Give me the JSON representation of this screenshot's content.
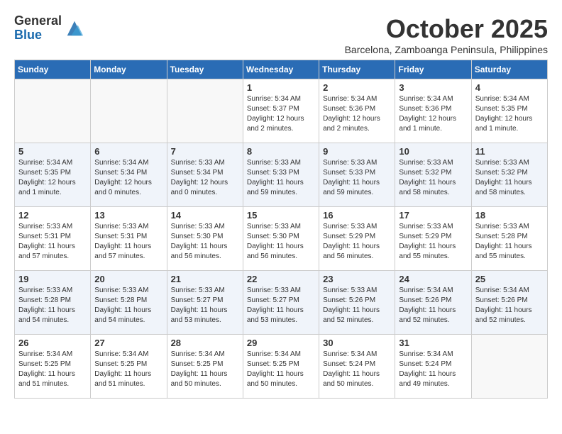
{
  "header": {
    "logo_general": "General",
    "logo_blue": "Blue",
    "month_title": "October 2025",
    "subtitle": "Barcelona, Zamboanga Peninsula, Philippines"
  },
  "weekdays": [
    "Sunday",
    "Monday",
    "Tuesday",
    "Wednesday",
    "Thursday",
    "Friday",
    "Saturday"
  ],
  "weeks": [
    [
      {
        "day": "",
        "info": ""
      },
      {
        "day": "",
        "info": ""
      },
      {
        "day": "",
        "info": ""
      },
      {
        "day": "1",
        "info": "Sunrise: 5:34 AM\nSunset: 5:37 PM\nDaylight: 12 hours\nand 2 minutes."
      },
      {
        "day": "2",
        "info": "Sunrise: 5:34 AM\nSunset: 5:36 PM\nDaylight: 12 hours\nand 2 minutes."
      },
      {
        "day": "3",
        "info": "Sunrise: 5:34 AM\nSunset: 5:36 PM\nDaylight: 12 hours\nand 1 minute."
      },
      {
        "day": "4",
        "info": "Sunrise: 5:34 AM\nSunset: 5:35 PM\nDaylight: 12 hours\nand 1 minute."
      }
    ],
    [
      {
        "day": "5",
        "info": "Sunrise: 5:34 AM\nSunset: 5:35 PM\nDaylight: 12 hours\nand 1 minute."
      },
      {
        "day": "6",
        "info": "Sunrise: 5:34 AM\nSunset: 5:34 PM\nDaylight: 12 hours\nand 0 minutes."
      },
      {
        "day": "7",
        "info": "Sunrise: 5:33 AM\nSunset: 5:34 PM\nDaylight: 12 hours\nand 0 minutes."
      },
      {
        "day": "8",
        "info": "Sunrise: 5:33 AM\nSunset: 5:33 PM\nDaylight: 11 hours\nand 59 minutes."
      },
      {
        "day": "9",
        "info": "Sunrise: 5:33 AM\nSunset: 5:33 PM\nDaylight: 11 hours\nand 59 minutes."
      },
      {
        "day": "10",
        "info": "Sunrise: 5:33 AM\nSunset: 5:32 PM\nDaylight: 11 hours\nand 58 minutes."
      },
      {
        "day": "11",
        "info": "Sunrise: 5:33 AM\nSunset: 5:32 PM\nDaylight: 11 hours\nand 58 minutes."
      }
    ],
    [
      {
        "day": "12",
        "info": "Sunrise: 5:33 AM\nSunset: 5:31 PM\nDaylight: 11 hours\nand 57 minutes."
      },
      {
        "day": "13",
        "info": "Sunrise: 5:33 AM\nSunset: 5:31 PM\nDaylight: 11 hours\nand 57 minutes."
      },
      {
        "day": "14",
        "info": "Sunrise: 5:33 AM\nSunset: 5:30 PM\nDaylight: 11 hours\nand 56 minutes."
      },
      {
        "day": "15",
        "info": "Sunrise: 5:33 AM\nSunset: 5:30 PM\nDaylight: 11 hours\nand 56 minutes."
      },
      {
        "day": "16",
        "info": "Sunrise: 5:33 AM\nSunset: 5:29 PM\nDaylight: 11 hours\nand 56 minutes."
      },
      {
        "day": "17",
        "info": "Sunrise: 5:33 AM\nSunset: 5:29 PM\nDaylight: 11 hours\nand 55 minutes."
      },
      {
        "day": "18",
        "info": "Sunrise: 5:33 AM\nSunset: 5:28 PM\nDaylight: 11 hours\nand 55 minutes."
      }
    ],
    [
      {
        "day": "19",
        "info": "Sunrise: 5:33 AM\nSunset: 5:28 PM\nDaylight: 11 hours\nand 54 minutes."
      },
      {
        "day": "20",
        "info": "Sunrise: 5:33 AM\nSunset: 5:28 PM\nDaylight: 11 hours\nand 54 minutes."
      },
      {
        "day": "21",
        "info": "Sunrise: 5:33 AM\nSunset: 5:27 PM\nDaylight: 11 hours\nand 53 minutes."
      },
      {
        "day": "22",
        "info": "Sunrise: 5:33 AM\nSunset: 5:27 PM\nDaylight: 11 hours\nand 53 minutes."
      },
      {
        "day": "23",
        "info": "Sunrise: 5:33 AM\nSunset: 5:26 PM\nDaylight: 11 hours\nand 52 minutes."
      },
      {
        "day": "24",
        "info": "Sunrise: 5:34 AM\nSunset: 5:26 PM\nDaylight: 11 hours\nand 52 minutes."
      },
      {
        "day": "25",
        "info": "Sunrise: 5:34 AM\nSunset: 5:26 PM\nDaylight: 11 hours\nand 52 minutes."
      }
    ],
    [
      {
        "day": "26",
        "info": "Sunrise: 5:34 AM\nSunset: 5:25 PM\nDaylight: 11 hours\nand 51 minutes."
      },
      {
        "day": "27",
        "info": "Sunrise: 5:34 AM\nSunset: 5:25 PM\nDaylight: 11 hours\nand 51 minutes."
      },
      {
        "day": "28",
        "info": "Sunrise: 5:34 AM\nSunset: 5:25 PM\nDaylight: 11 hours\nand 50 minutes."
      },
      {
        "day": "29",
        "info": "Sunrise: 5:34 AM\nSunset: 5:25 PM\nDaylight: 11 hours\nand 50 minutes."
      },
      {
        "day": "30",
        "info": "Sunrise: 5:34 AM\nSunset: 5:24 PM\nDaylight: 11 hours\nand 50 minutes."
      },
      {
        "day": "31",
        "info": "Sunrise: 5:34 AM\nSunset: 5:24 PM\nDaylight: 11 hours\nand 49 minutes."
      },
      {
        "day": "",
        "info": ""
      }
    ]
  ]
}
